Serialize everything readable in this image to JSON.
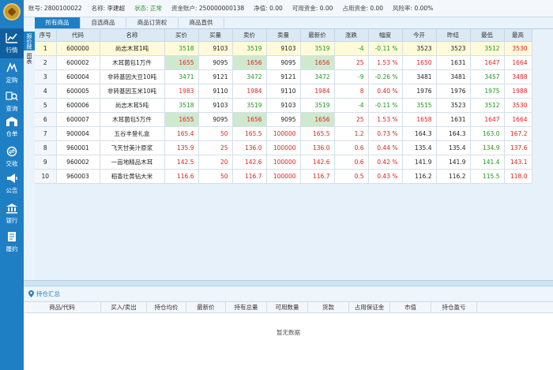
{
  "account": {
    "acct_label": "账号:",
    "acct_value": "2800100022",
    "name_label": "名称:",
    "name_value": "李建超",
    "status_label": "状态:",
    "status_value": "正常",
    "fund_label": "资金账户:",
    "fund_value": "250000000138",
    "net_label": "净值:",
    "net_value": "0.00",
    "avail_label": "可用资金:",
    "avail_value": "0.00",
    "used_label": "占用资金:",
    "used_value": "0.00",
    "risk_label": "风险率:",
    "risk_value": "0.00%"
  },
  "sidebar": {
    "items": [
      {
        "label": "行情",
        "icon": "chart-icon"
      },
      {
        "label": "定购",
        "icon": "signature-icon"
      },
      {
        "label": "查询",
        "icon": "search-icon"
      },
      {
        "label": "仓单",
        "icon": "warehouse-icon"
      },
      {
        "label": "交收",
        "icon": "exchange-icon"
      },
      {
        "label": "公告",
        "icon": "megaphone-icon"
      },
      {
        "label": "银行",
        "icon": "bank-icon"
      },
      {
        "label": "履约",
        "icon": "contract-icon"
      }
    ]
  },
  "side_tabs": {
    "quote": "报价牌",
    "chart": "图表"
  },
  "tabs": [
    "所有商品",
    "自选商品",
    "商品订货权",
    "商品直供"
  ],
  "quote_table": {
    "headers": [
      "序号",
      "代码",
      "名称",
      "买价",
      "买量",
      "卖价",
      "卖量",
      "最新价",
      "涨跌",
      "幅度",
      "今开",
      "昨结",
      "最低",
      "最高"
    ],
    "rows": [
      {
        "idx": "1",
        "code": "600000",
        "name": "尚志木耳1吨",
        "bid": "3518",
        "bidq": "9103",
        "ask": "3519",
        "askq": "9103",
        "last": "3519",
        "chg": "-4",
        "pct": "-0.11 %",
        "open": "3523",
        "pre": "3523",
        "low": "3512",
        "high": "3530"
      },
      {
        "idx": "2",
        "code": "600002",
        "name": "木耳菌包1万件",
        "bid": "1655",
        "bidq": "9095",
        "ask": "1656",
        "askq": "9095",
        "last": "1656",
        "chg": "25",
        "pct": "1.53 %",
        "open": "1650",
        "pre": "1631",
        "low": "1647",
        "high": "1664"
      },
      {
        "idx": "3",
        "code": "600004",
        "name": "非转基因大豆10吨",
        "bid": "3471",
        "bidq": "9121",
        "ask": "3472",
        "askq": "9121",
        "last": "3472",
        "chg": "-9",
        "pct": "-0.26 %",
        "open": "3481",
        "pre": "3481",
        "low": "3457",
        "high": "3488"
      },
      {
        "idx": "4",
        "code": "600005",
        "name": "非转基因玉米10吨",
        "bid": "1983",
        "bidq": "9110",
        "ask": "1984",
        "askq": "9110",
        "last": "1984",
        "chg": "8",
        "pct": "0.40 %",
        "open": "1976",
        "pre": "1976",
        "low": "1975",
        "high": "1988"
      },
      {
        "idx": "5",
        "code": "600006",
        "name": "尚志木耳5吨",
        "bid": "3518",
        "bidq": "9103",
        "ask": "3519",
        "askq": "9103",
        "last": "3519",
        "chg": "-4",
        "pct": "-0.11 %",
        "open": "3515",
        "pre": "3523",
        "low": "3512",
        "high": "3530"
      },
      {
        "idx": "6",
        "code": "600007",
        "name": "木耳菌包5万件",
        "bid": "1655",
        "bidq": "9095",
        "ask": "1656",
        "askq": "9095",
        "last": "1656",
        "chg": "25",
        "pct": "1.53 %",
        "open": "1658",
        "pre": "1631",
        "low": "1647",
        "high": "1664"
      },
      {
        "idx": "7",
        "code": "900004",
        "name": "五谷丰登礼盒",
        "bid": "165.4",
        "bidq": "50",
        "ask": "165.5",
        "askq": "100000",
        "last": "165.5",
        "chg": "1.2",
        "pct": "0.73 %",
        "open": "164.3",
        "pre": "164.3",
        "low": "163.0",
        "high": "167.2"
      },
      {
        "idx": "8",
        "code": "960001",
        "name": "飞天甘美汁原浆",
        "bid": "135.9",
        "bidq": "25",
        "ask": "136.0",
        "askq": "100000",
        "last": "136.0",
        "chg": "0.6",
        "pct": "0.44 %",
        "open": "135.4",
        "pre": "135.4",
        "low": "134.9",
        "high": "137.6"
      },
      {
        "idx": "9",
        "code": "960002",
        "name": "一亩地精品木耳",
        "bid": "142.5",
        "bidq": "20",
        "ask": "142.6",
        "askq": "100000",
        "last": "142.6",
        "chg": "0.6",
        "pct": "0.42 %",
        "open": "141.9",
        "pre": "141.9",
        "low": "141.4",
        "high": "143.1"
      },
      {
        "idx": "10",
        "code": "960003",
        "name": "稻香壮黄钻大米",
        "bid": "116.6",
        "bidq": "50",
        "ask": "116.7",
        "askq": "100000",
        "last": "116.7",
        "chg": "0.5",
        "pct": "0.43 %",
        "open": "116.2",
        "pre": "116.2",
        "low": "115.5",
        "high": "118.0"
      }
    ]
  },
  "positions": {
    "title": "持仓汇总",
    "headers": [
      "商品/代码",
      "买入/卖出",
      "持仓均价",
      "最新价",
      "持有总量",
      "可用数量",
      "货款",
      "占用保证金",
      "市值",
      "持仓盈亏"
    ],
    "empty_text": "暂无数据"
  },
  "colors": {
    "accent": "#1f7fc4",
    "up": "#e02020",
    "down": "#1b9a1b",
    "highlight": "#cfe9cf",
    "selected_row": "#fffbd8"
  }
}
